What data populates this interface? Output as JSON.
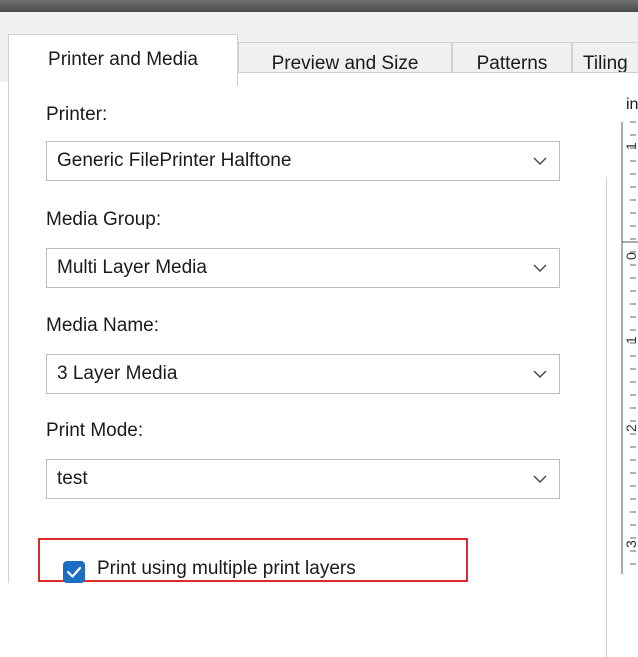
{
  "tabs": [
    {
      "label": "Printer and Media",
      "active": true
    },
    {
      "label": "Preview and Size",
      "active": false
    },
    {
      "label": "Patterns",
      "active": false
    },
    {
      "label": "Tiling",
      "active": false
    }
  ],
  "fields": {
    "printer": {
      "label": "Printer:",
      "value": "Generic FilePrinter Halftone"
    },
    "media_group": {
      "label": "Media Group:",
      "value": "Multi Layer Media"
    },
    "media_name": {
      "label": "Media Name:",
      "value": "3 Layer Media"
    },
    "print_mode": {
      "label": "Print Mode:",
      "value": "test"
    }
  },
  "multi_layer_checkbox": {
    "label": "Print using multiple print layers",
    "checked": true
  },
  "preview": {
    "units_label": "in",
    "ruler_ticks": [
      "1",
      "0",
      "1",
      "2",
      "3"
    ]
  },
  "colors": {
    "accent": "#1b6ec2",
    "highlight": "#e02a2a"
  }
}
